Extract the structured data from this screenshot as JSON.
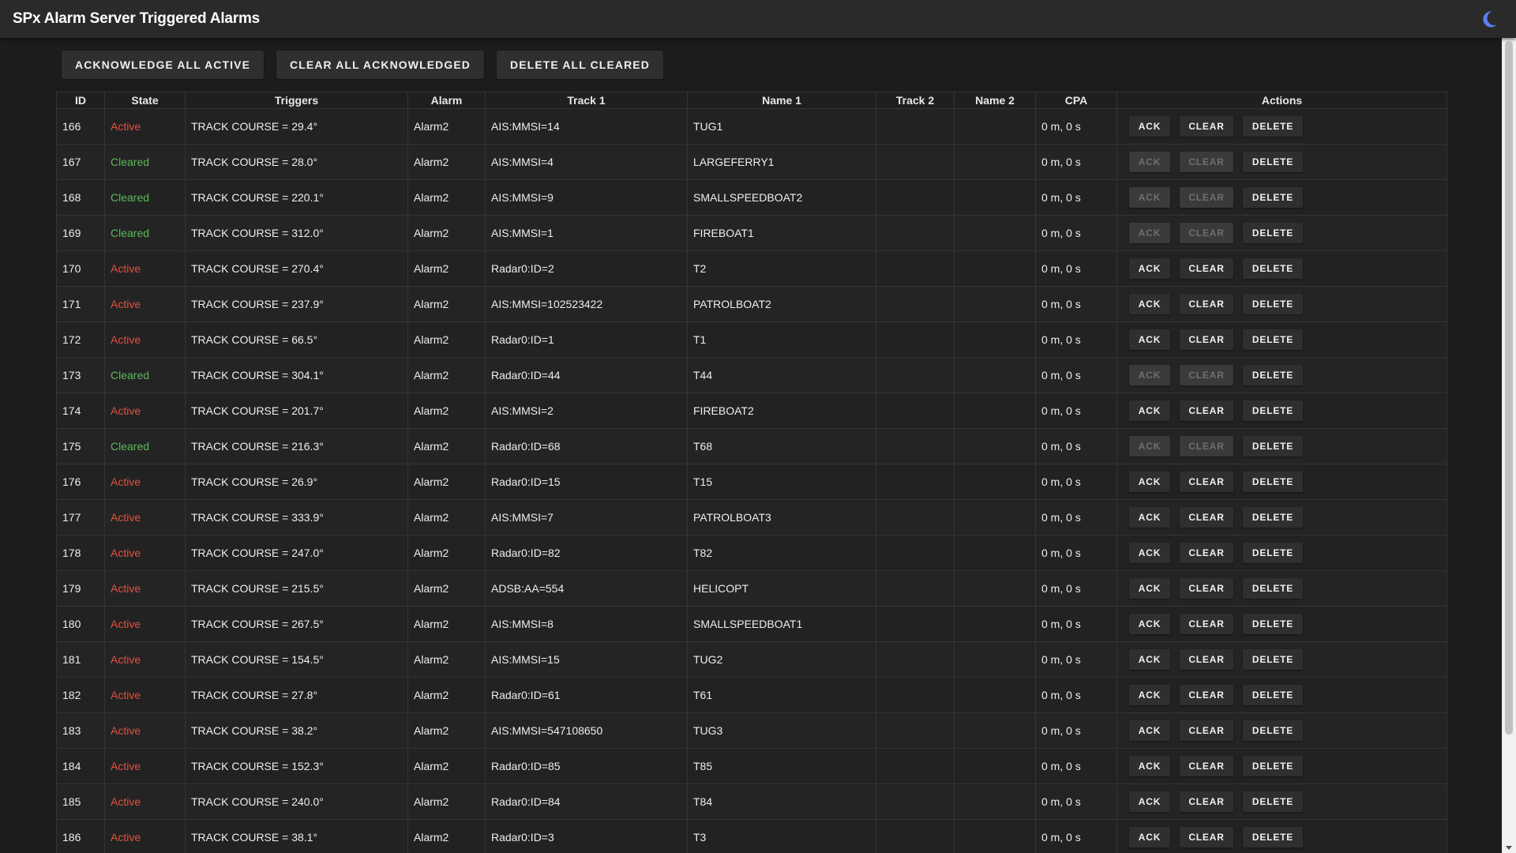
{
  "app": {
    "title": "SPx Alarm Server Triggered Alarms"
  },
  "icons": {
    "theme_toggle": "moon-icon"
  },
  "colors": {
    "app_bar": "#2a2a2a",
    "background": "#1c1c1c",
    "active": "#e25141",
    "cleared": "#5cb85c",
    "moon": "#5b7ff2"
  },
  "toolbar": {
    "ack_all_label": "ACKNOWLEDGE ALL ACTIVE",
    "clear_all_label": "CLEAR ALL ACKNOWLEDGED",
    "delete_all_label": "DELETE ALL CLEARED"
  },
  "table": {
    "headers": {
      "id": "ID",
      "state": "State",
      "triggers": "Triggers",
      "alarm": "Alarm",
      "track1": "Track 1",
      "name1": "Name 1",
      "track2": "Track 2",
      "name2": "Name 2",
      "cpa": "CPA",
      "actions": "Actions"
    },
    "action_labels": {
      "ack": "ACK",
      "clear": "CLEAR",
      "delete": "DELETE"
    },
    "rows": [
      {
        "id": "166",
        "state": "Active",
        "trigger": "TRACK COURSE = 29.4°",
        "alarm": "Alarm2",
        "track1": "AIS:MMSI=14",
        "name1": "TUG1",
        "track2": "",
        "name2": "",
        "cpa": "0 m, 0 s"
      },
      {
        "id": "167",
        "state": "Cleared",
        "trigger": "TRACK COURSE = 28.0°",
        "alarm": "Alarm2",
        "track1": "AIS:MMSI=4",
        "name1": "LARGEFERRY1",
        "track2": "",
        "name2": "",
        "cpa": "0 m, 0 s"
      },
      {
        "id": "168",
        "state": "Cleared",
        "trigger": "TRACK COURSE = 220.1°",
        "alarm": "Alarm2",
        "track1": "AIS:MMSI=9",
        "name1": "SMALLSPEEDBOAT2",
        "track2": "",
        "name2": "",
        "cpa": "0 m, 0 s"
      },
      {
        "id": "169",
        "state": "Cleared",
        "trigger": "TRACK COURSE = 312.0°",
        "alarm": "Alarm2",
        "track1": "AIS:MMSI=1",
        "name1": "FIREBOAT1",
        "track2": "",
        "name2": "",
        "cpa": "0 m, 0 s"
      },
      {
        "id": "170",
        "state": "Active",
        "trigger": "TRACK COURSE = 270.4°",
        "alarm": "Alarm2",
        "track1": "Radar0:ID=2",
        "name1": "T2",
        "track2": "",
        "name2": "",
        "cpa": "0 m, 0 s"
      },
      {
        "id": "171",
        "state": "Active",
        "trigger": "TRACK COURSE = 237.9°",
        "alarm": "Alarm2",
        "track1": "AIS:MMSI=102523422",
        "name1": "PATROLBOAT2",
        "track2": "",
        "name2": "",
        "cpa": "0 m, 0 s"
      },
      {
        "id": "172",
        "state": "Active",
        "trigger": "TRACK COURSE = 66.5°",
        "alarm": "Alarm2",
        "track1": "Radar0:ID=1",
        "name1": "T1",
        "track2": "",
        "name2": "",
        "cpa": "0 m, 0 s"
      },
      {
        "id": "173",
        "state": "Cleared",
        "trigger": "TRACK COURSE = 304.1°",
        "alarm": "Alarm2",
        "track1": "Radar0:ID=44",
        "name1": "T44",
        "track2": "",
        "name2": "",
        "cpa": "0 m, 0 s"
      },
      {
        "id": "174",
        "state": "Active",
        "trigger": "TRACK COURSE = 201.7°",
        "alarm": "Alarm2",
        "track1": "AIS:MMSI=2",
        "name1": "FIREBOAT2",
        "track2": "",
        "name2": "",
        "cpa": "0 m, 0 s"
      },
      {
        "id": "175",
        "state": "Cleared",
        "trigger": "TRACK COURSE = 216.3°",
        "alarm": "Alarm2",
        "track1": "Radar0:ID=68",
        "name1": "T68",
        "track2": "",
        "name2": "",
        "cpa": "0 m, 0 s"
      },
      {
        "id": "176",
        "state": "Active",
        "trigger": "TRACK COURSE = 26.9°",
        "alarm": "Alarm2",
        "track1": "Radar0:ID=15",
        "name1": "T15",
        "track2": "",
        "name2": "",
        "cpa": "0 m, 0 s"
      },
      {
        "id": "177",
        "state": "Active",
        "trigger": "TRACK COURSE = 333.9°",
        "alarm": "Alarm2",
        "track1": "AIS:MMSI=7",
        "name1": "PATROLBOAT3",
        "track2": "",
        "name2": "",
        "cpa": "0 m, 0 s"
      },
      {
        "id": "178",
        "state": "Active",
        "trigger": "TRACK COURSE = 247.0°",
        "alarm": "Alarm2",
        "track1": "Radar0:ID=82",
        "name1": "T82",
        "track2": "",
        "name2": "",
        "cpa": "0 m, 0 s"
      },
      {
        "id": "179",
        "state": "Active",
        "trigger": "TRACK COURSE = 215.5°",
        "alarm": "Alarm2",
        "track1": "ADSB:AA=554",
        "name1": "HELICOPT",
        "track2": "",
        "name2": "",
        "cpa": "0 m, 0 s"
      },
      {
        "id": "180",
        "state": "Active",
        "trigger": "TRACK COURSE = 267.5°",
        "alarm": "Alarm2",
        "track1": "AIS:MMSI=8",
        "name1": "SMALLSPEEDBOAT1",
        "track2": "",
        "name2": "",
        "cpa": "0 m, 0 s"
      },
      {
        "id": "181",
        "state": "Active",
        "trigger": "TRACK COURSE = 154.5°",
        "alarm": "Alarm2",
        "track1": "AIS:MMSI=15",
        "name1": "TUG2",
        "track2": "",
        "name2": "",
        "cpa": "0 m, 0 s"
      },
      {
        "id": "182",
        "state": "Active",
        "trigger": "TRACK COURSE = 27.8°",
        "alarm": "Alarm2",
        "track1": "Radar0:ID=61",
        "name1": "T61",
        "track2": "",
        "name2": "",
        "cpa": "0 m, 0 s"
      },
      {
        "id": "183",
        "state": "Active",
        "trigger": "TRACK COURSE = 38.2°",
        "alarm": "Alarm2",
        "track1": "AIS:MMSI=547108650",
        "name1": "TUG3",
        "track2": "",
        "name2": "",
        "cpa": "0 m, 0 s"
      },
      {
        "id": "184",
        "state": "Active",
        "trigger": "TRACK COURSE = 152.3°",
        "alarm": "Alarm2",
        "track1": "Radar0:ID=85",
        "name1": "T85",
        "track2": "",
        "name2": "",
        "cpa": "0 m, 0 s"
      },
      {
        "id": "185",
        "state": "Active",
        "trigger": "TRACK COURSE = 240.0°",
        "alarm": "Alarm2",
        "track1": "Radar0:ID=84",
        "name1": "T84",
        "track2": "",
        "name2": "",
        "cpa": "0 m, 0 s"
      },
      {
        "id": "186",
        "state": "Active",
        "trigger": "TRACK COURSE = 38.1°",
        "alarm": "Alarm2",
        "track1": "Radar0:ID=3",
        "name1": "T3",
        "track2": "",
        "name2": "",
        "cpa": "0 m, 0 s"
      }
    ]
  }
}
